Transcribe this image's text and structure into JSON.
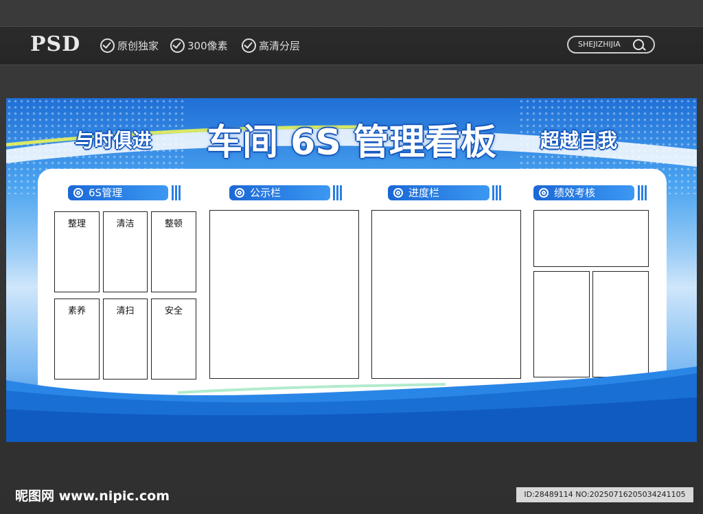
{
  "header": {
    "brand": "PSD",
    "features": [
      "原创独家",
      "300像素",
      "高清分层"
    ],
    "search_label": "SHEJIZHIJIA"
  },
  "board": {
    "title": "车间 6S 管理看板",
    "slogan_left": "与时俱进",
    "slogan_right": "超越自我",
    "sections": [
      {
        "title": "6S管理",
        "cells": [
          "整理",
          "清洁",
          "整顿",
          "素养",
          "清扫",
          "安全"
        ]
      },
      {
        "title": "公示栏"
      },
      {
        "title": "进度栏"
      },
      {
        "title": "绩效考核"
      }
    ]
  },
  "footer": {
    "site": "昵图网 www.nipic.com",
    "id_text": "ID:28489114 NO:20250716205034241105"
  },
  "colors": {
    "page_bg": "#333333",
    "board_blue": "#1f6fd6",
    "section_head": "#2a7fe3"
  }
}
